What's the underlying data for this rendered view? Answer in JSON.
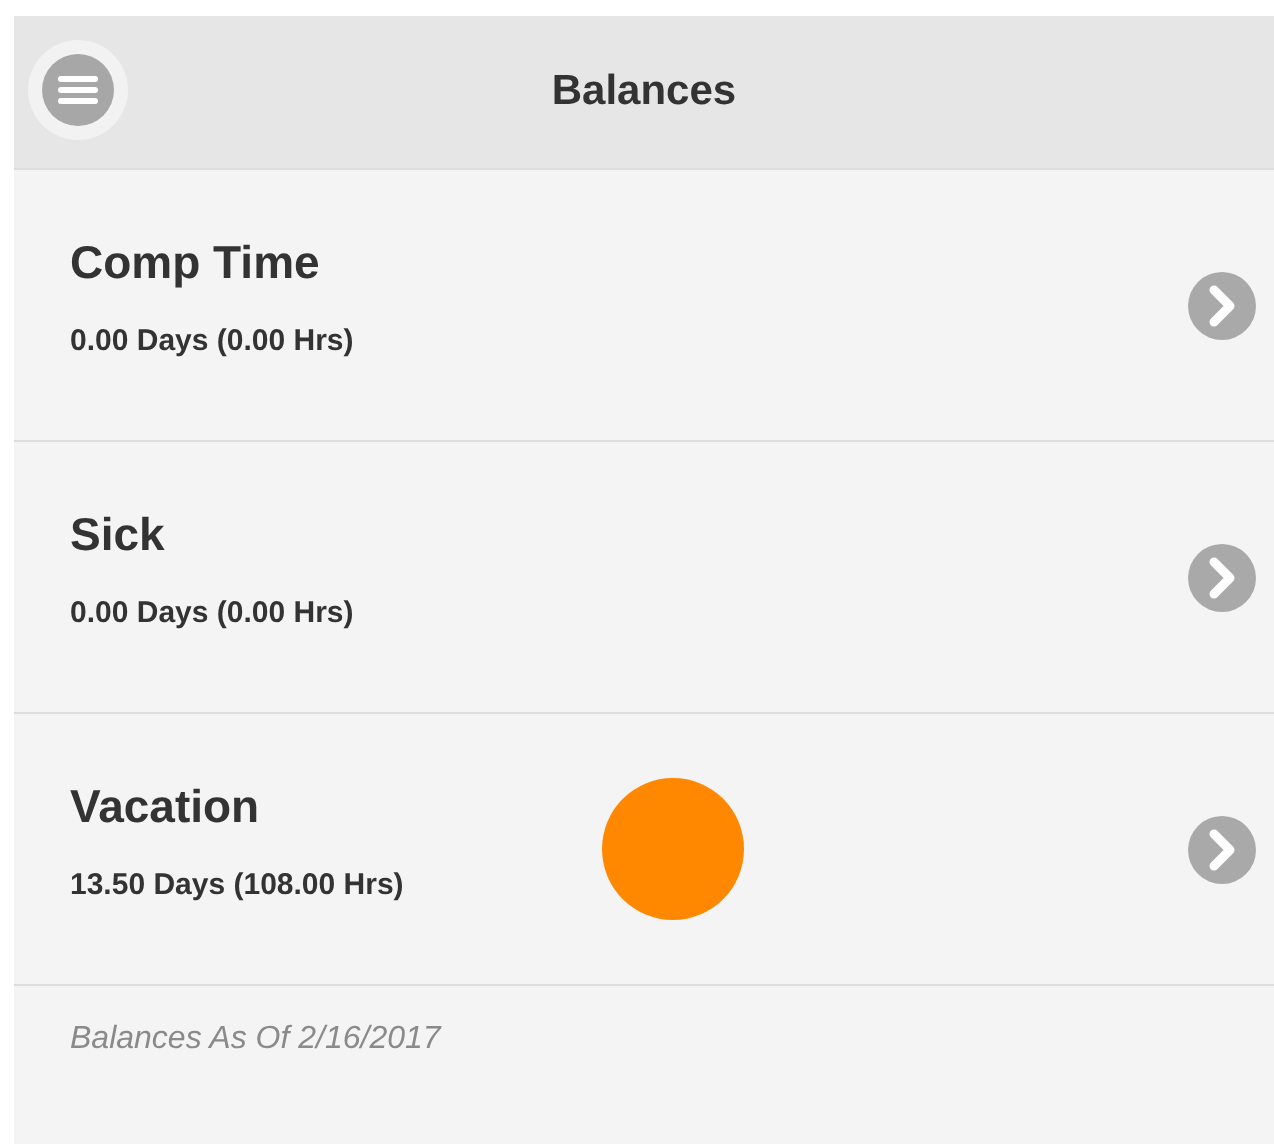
{
  "header": {
    "title": "Balances"
  },
  "balances": [
    {
      "name": "Comp Time",
      "amount": "0.00 Days (0.00 Hrs)"
    },
    {
      "name": "Sick",
      "amount": "0.00 Days (0.00 Hrs)"
    },
    {
      "name": "Vacation",
      "amount": "13.50 Days (108.00 Hrs)"
    }
  ],
  "footer": {
    "note": "Balances As Of 2/16/2017"
  }
}
